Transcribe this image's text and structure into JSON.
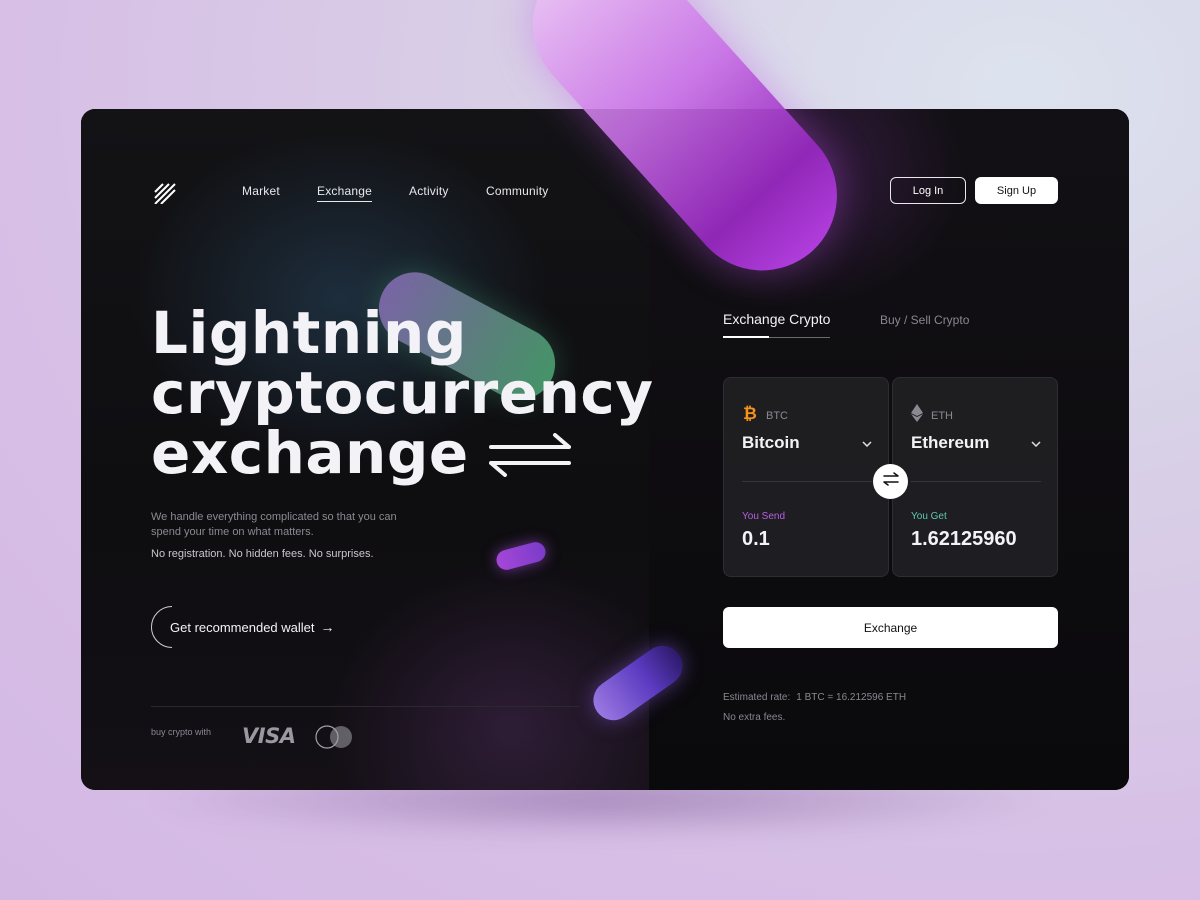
{
  "nav": {
    "items": [
      {
        "label": "Market",
        "active": false
      },
      {
        "label": "Exchange",
        "active": true
      },
      {
        "label": "Activity",
        "active": false
      },
      {
        "label": "Community",
        "active": false
      }
    ],
    "login_label": "Log In",
    "signup_label": "Sign Up",
    "logo_icon": "stripes-logo-icon"
  },
  "hero": {
    "title_lines": [
      "Lightning",
      "cryptocurrency",
      "exchange"
    ],
    "title_icon": "swap-arrows-icon",
    "description": "We handle everything complicated so that you can spend your time on what matters.",
    "tagline": "No registration. No hidden fees. No surprises.",
    "cta_label": "Get recommended wallet",
    "cta_icon": "arrow-right-icon"
  },
  "payment": {
    "label": "buy crypto with",
    "visa": "VISA",
    "mastercard_icon": "mastercard-icon"
  },
  "exchange": {
    "tabs": [
      {
        "label": "Exchange Crypto",
        "active": true
      },
      {
        "label": "Buy / Sell Crypto",
        "active": false
      }
    ],
    "send": {
      "ticker": "BTC",
      "name": "Bitcoin",
      "icon": "bitcoin-icon",
      "amount_label": "You Send",
      "amount": "0.1"
    },
    "get": {
      "ticker": "ETH",
      "name": "Ethereum",
      "icon": "ethereum-icon",
      "amount_label": "You Get",
      "amount": "1.62125960"
    },
    "button_label": "Exchange",
    "rate_label": "Estimated rate:",
    "rate_value": "1 BTC = 16.212596 ETH",
    "fees_note": "No extra fees."
  },
  "colors": {
    "accent_purple": "#b760e0",
    "accent_teal": "#5ec9b0",
    "bitcoin_orange": "#f7931a",
    "background_card": "#0b0a0d"
  }
}
